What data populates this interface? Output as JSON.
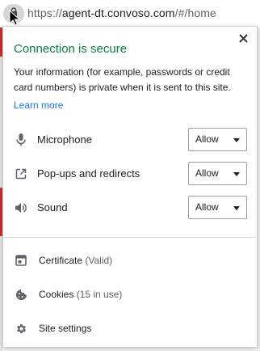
{
  "address_bar": {
    "scheme": "https://",
    "host": "agent-dt.convoso.com",
    "path": "/#/home"
  },
  "popup": {
    "title": "Connection is secure",
    "description": "Your information (for example, passwords or credit card numbers) is private when it is sent to this site.",
    "learn_more": "Learn more",
    "permissions": [
      {
        "label": "Microphone",
        "value": "Allow",
        "icon": "microphone-icon"
      },
      {
        "label": "Pop-ups and redirects",
        "value": "Allow",
        "icon": "popup-icon"
      },
      {
        "label": "Sound",
        "value": "Allow",
        "icon": "speaker-icon"
      }
    ],
    "links": [
      {
        "label": "Certificate",
        "detail": "(Valid)",
        "icon": "certificate-icon"
      },
      {
        "label": "Cookies",
        "detail": "(15 in use)",
        "icon": "cookie-icon"
      },
      {
        "label": "Site settings",
        "detail": "",
        "icon": "gear-icon"
      }
    ]
  },
  "colors": {
    "secure_green": "#0b8043",
    "link_blue": "#1a73e8"
  }
}
